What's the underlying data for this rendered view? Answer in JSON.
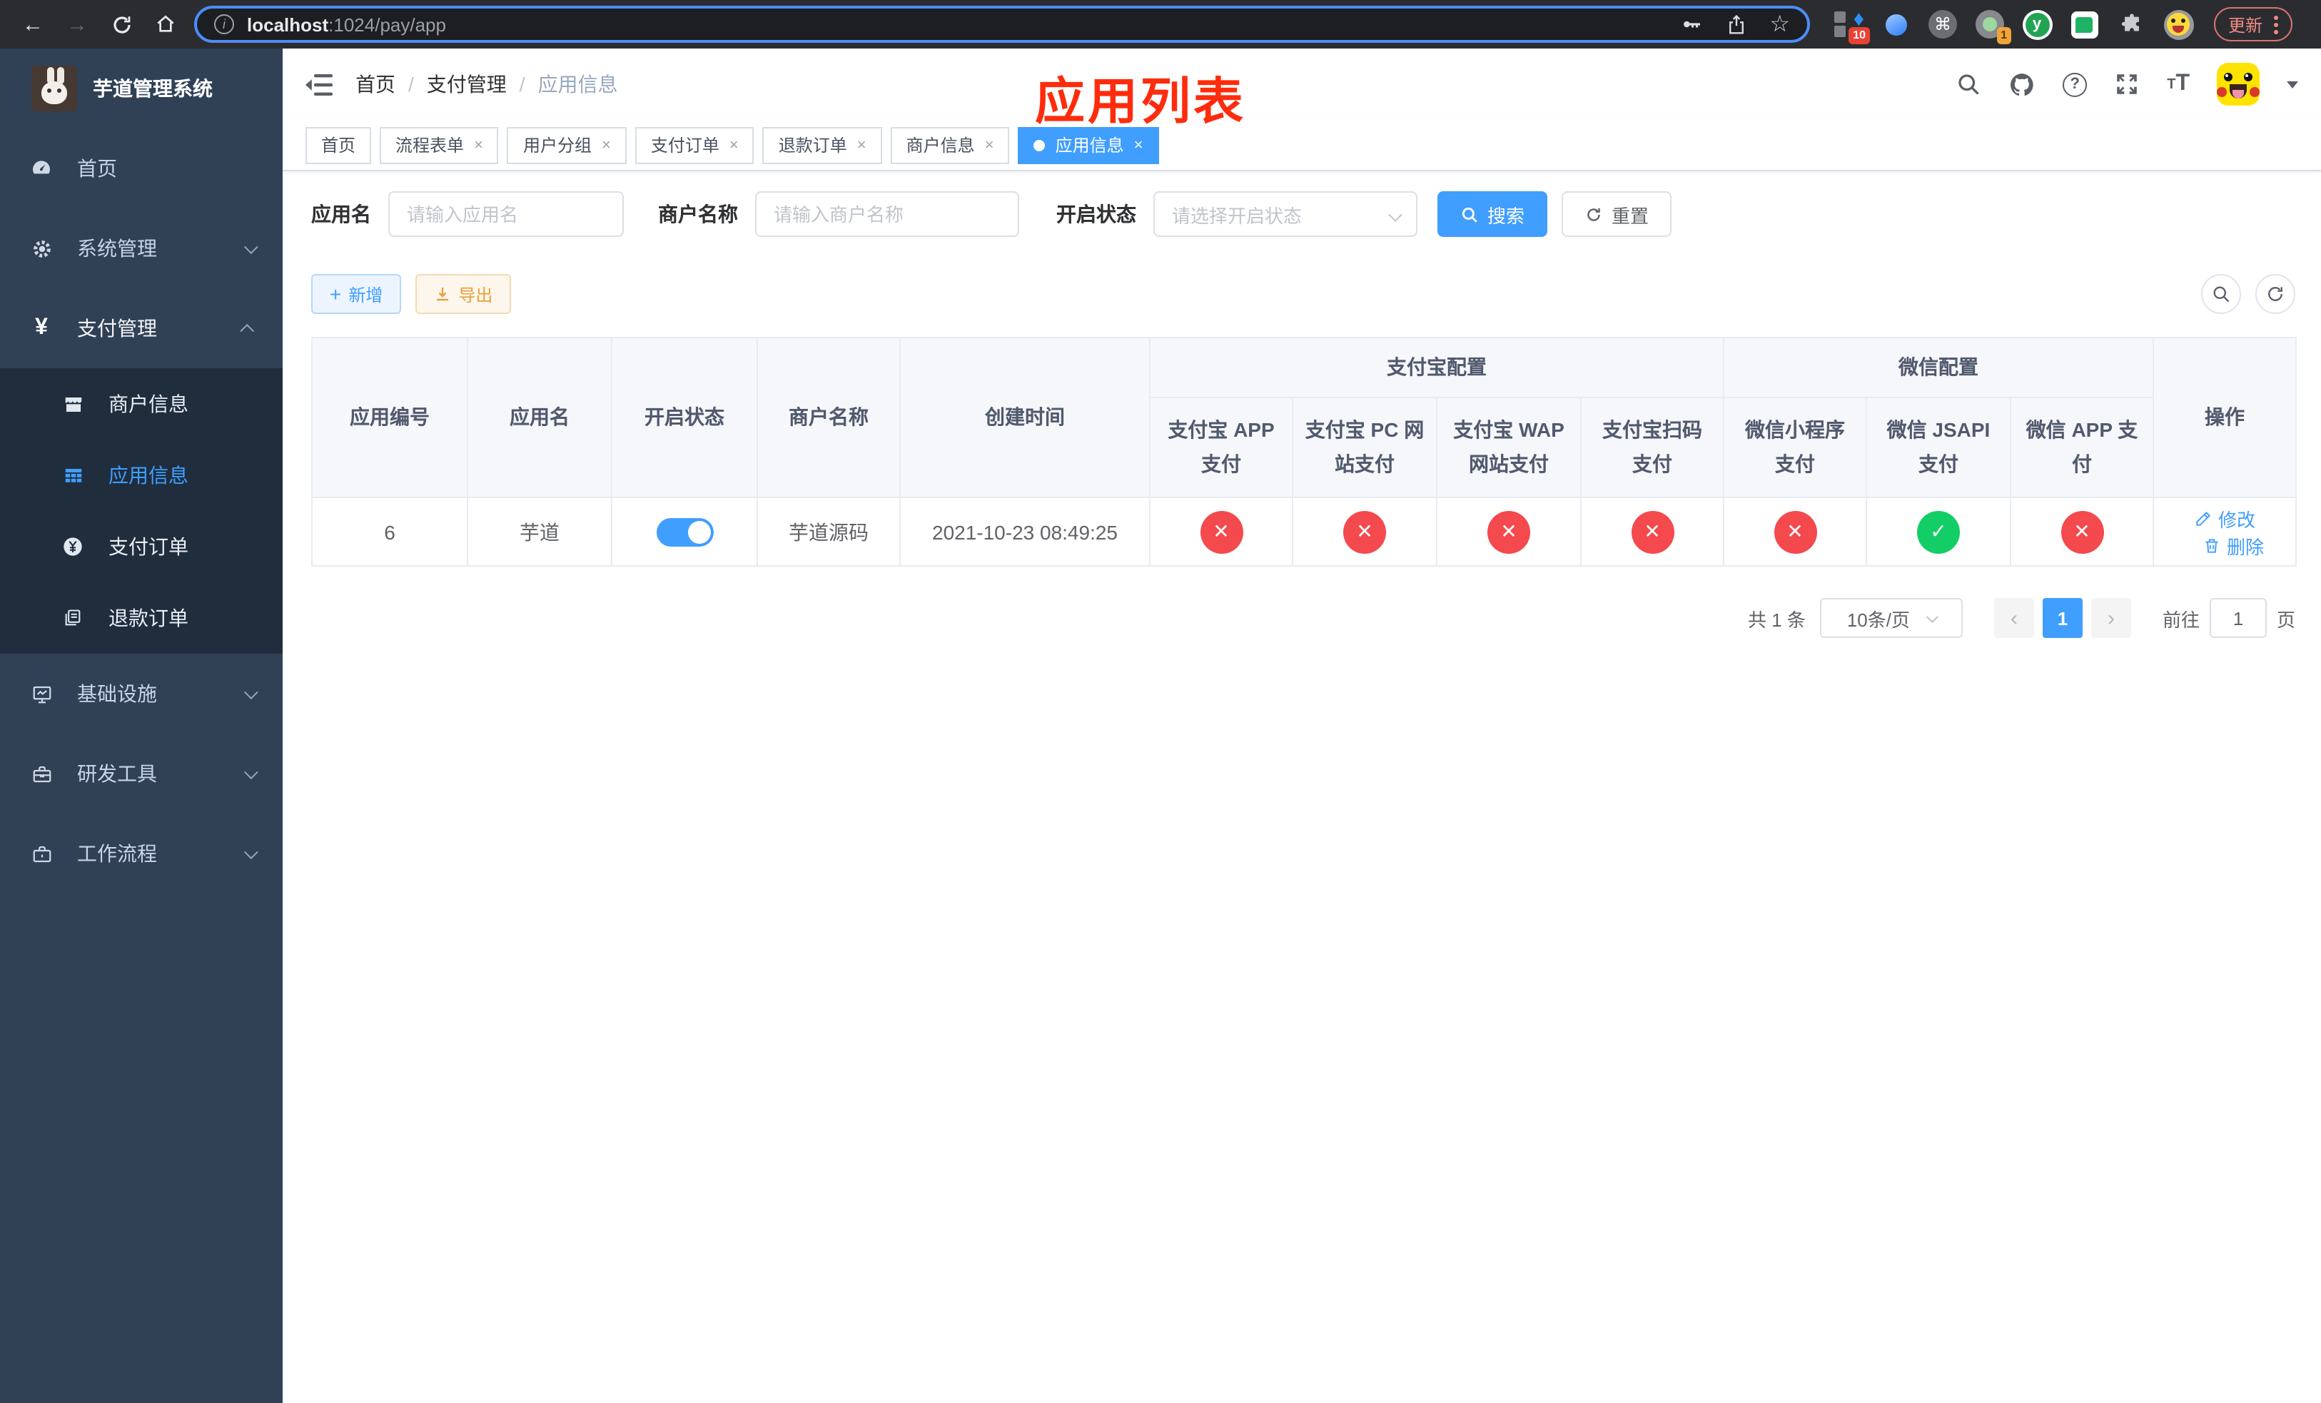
{
  "colors": {
    "primary": "#409eff",
    "danger": "#f4494d",
    "success": "#13ce66",
    "warning": "#e6a23c",
    "annotation_red": "#fe2c0c",
    "sidebar_bg": "#304156",
    "submenu_bg": "#1f2d3d"
  },
  "icons": {
    "close_x": "×",
    "yen": "¥",
    "cmd": "⌘",
    "star": "☆",
    "y_letter": "y",
    "info_i": "i",
    "question": "?",
    "t_small": "T",
    "t_large": "T",
    "prev_arrow": "‹",
    "next_arrow": "›",
    "back_arrow": "←",
    "forward_arrow": "→",
    "plus": "+"
  },
  "browser": {
    "url_host": "localhost",
    "url_rest": ":1024/pay/app",
    "update_button": "更新",
    "ext_badge_a": "10",
    "ext_badge_b": "1"
  },
  "sidebar": {
    "title": "芋道管理系统",
    "menu": [
      {
        "label": "首页"
      },
      {
        "label": "系统管理"
      },
      {
        "label": "支付管理",
        "expanded": true
      },
      {
        "label": "基础设施"
      },
      {
        "label": "研发工具"
      },
      {
        "label": "工作流程"
      }
    ],
    "submenu": [
      {
        "label": "商户信息"
      },
      {
        "label": "应用信息",
        "active": true
      },
      {
        "label": "支付订单"
      },
      {
        "label": "退款订单"
      }
    ]
  },
  "navbar": {
    "breadcrumb": [
      "首页",
      "支付管理",
      "应用信息"
    ]
  },
  "annotation": {
    "text": "应用列表"
  },
  "tabs": [
    {
      "label": "首页",
      "closable": false
    },
    {
      "label": "流程表单",
      "closable": true
    },
    {
      "label": "用户分组",
      "closable": true
    },
    {
      "label": "支付订单",
      "closable": true
    },
    {
      "label": "退款订单",
      "closable": true
    },
    {
      "label": "商户信息",
      "closable": true
    },
    {
      "label": "应用信息",
      "closable": true,
      "active": true
    }
  ],
  "filters": {
    "app_name_label": "应用名",
    "app_name_placeholder": "请输入应用名",
    "merchant_label": "商户名称",
    "merchant_placeholder": "请输入商户名称",
    "status_label": "开启状态",
    "status_placeholder": "请选择开启状态",
    "search_button": "搜索",
    "reset_button": "重置"
  },
  "toolbar": {
    "add_button": "新增",
    "export_button": "导出"
  },
  "table": {
    "headers": {
      "app_id": "应用编号",
      "app_name": "应用名",
      "status": "开启状态",
      "merchant": "商户名称",
      "created": "创建时间",
      "alipay_group": "支付宝配置",
      "wechat_group": "微信配置",
      "actions": "操作",
      "alipay_cols": [
        "支付宝 APP 支付",
        "支付宝 PC 网站支付",
        "支付宝 WAP 网站支付",
        "支付宝扫码支付"
      ],
      "wechat_cols": [
        "微信小程序支付",
        "微信 JSAPI 支付",
        "微信 APP 支付"
      ]
    },
    "row": {
      "app_id": "6",
      "app_name": "芋道",
      "enabled": true,
      "merchant": "芋道源码",
      "created": "2021-10-23 08:49:25",
      "alipay_status": [
        "close",
        "close",
        "close",
        "close"
      ],
      "wechat_status": [
        "close",
        "check",
        "close"
      ],
      "edit_link": "修改",
      "delete_link": "删除"
    }
  },
  "pagination": {
    "total": "共 1 条",
    "page_size": "10条/页",
    "current_page": "1",
    "goto_label": "前往",
    "goto_value": "1",
    "page_unit": "页"
  }
}
